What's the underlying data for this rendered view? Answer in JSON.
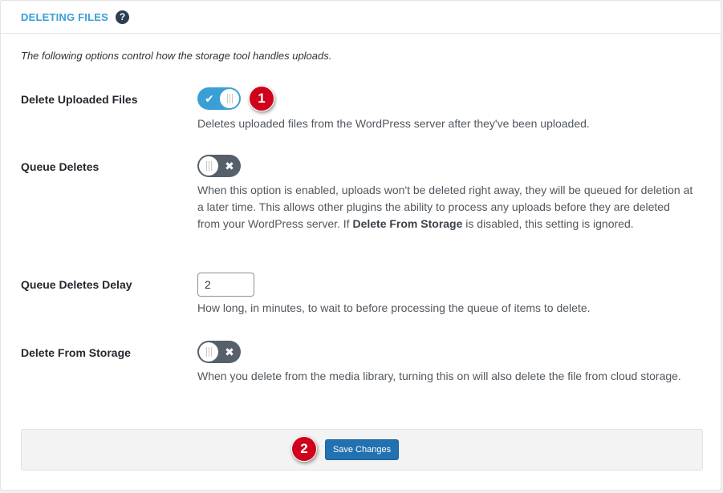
{
  "section": {
    "title": "DELETING FILES",
    "help_icon": "?",
    "description": "The following options control how the storage tool handles uploads."
  },
  "settings": {
    "delete_uploaded": {
      "label": "Delete Uploaded Files",
      "state": "on",
      "help": "Deletes uploaded files from the WordPress server after they've been uploaded."
    },
    "queue_deletes": {
      "label": "Queue Deletes",
      "state": "off",
      "help_part1": "When this option is enabled, uploads won't be deleted right away, they will be queued for deletion at a later time. This allows other plugins the ability to process any uploads before they are deleted from your WordPress server. If ",
      "help_bold": "Delete From Storage",
      "help_part2": " is disabled, this setting is ignored."
    },
    "queue_delay": {
      "label": "Queue Deletes Delay",
      "value": "2",
      "help": "How long, in minutes, to wait to before processing the queue of items to delete."
    },
    "delete_from_storage": {
      "label": "Delete From Storage",
      "state": "off",
      "help": "When you delete from the media library, turning this on will also delete the file from cloud storage."
    }
  },
  "toggle_glyphs": {
    "on": "✔",
    "off": "✖"
  },
  "badges": {
    "one": "1",
    "two": "2"
  },
  "footer": {
    "save_label": "Save Changes"
  },
  "colors": {
    "accent": "#3a9fd6",
    "toggle_off": "#55606b",
    "badge": "#d0021b",
    "button": "#2271b1"
  }
}
